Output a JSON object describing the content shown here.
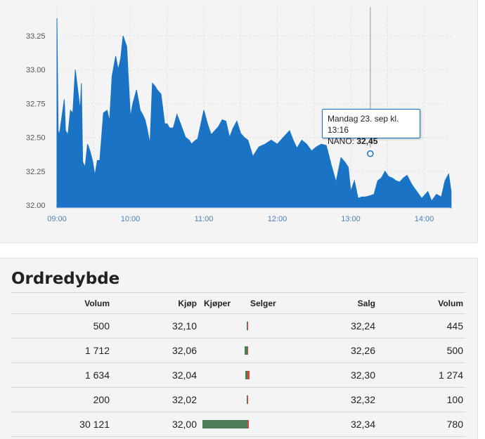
{
  "chart": {
    "x_ticks": [
      "09:00",
      "10:00",
      "11:00",
      "12:00",
      "13:00",
      "14:00"
    ],
    "y_ticks": [
      "33.25",
      "33.00",
      "32.75",
      "32.50",
      "32.25",
      "32.00"
    ],
    "tooltip": {
      "line1": "Mandag 23. sep kl. 13:16",
      "series": "NANO: ",
      "value": "32,45"
    },
    "colors": {
      "area": "#1a73c4",
      "axis_text": "#555555",
      "x_text": "#4a80b8"
    }
  },
  "chart_data": {
    "type": "area",
    "x_unit": "time",
    "ylim": [
      32.0,
      33.3
    ],
    "xlim": [
      "09:00",
      "14:22"
    ],
    "x": [
      "09:00",
      "09:01",
      "09:02",
      "09:04",
      "09:06",
      "09:07",
      "09:09",
      "09:11",
      "09:13",
      "09:15",
      "09:17",
      "09:19",
      "09:20",
      "09:21",
      "09:23",
      "09:25",
      "09:27",
      "09:29",
      "09:31",
      "09:33",
      "09:35",
      "09:38",
      "09:41",
      "09:43",
      "09:45",
      "09:48",
      "09:50",
      "09:52",
      "09:54",
      "09:57",
      "10:00",
      "10:02",
      "10:05",
      "10:08",
      "10:10",
      "10:12",
      "10:14",
      "10:16",
      "10:18",
      "10:20",
      "10:22",
      "10:25",
      "10:28",
      "10:30",
      "10:32",
      "10:35",
      "10:38",
      "10:41",
      "10:43",
      "10:45",
      "10:48",
      "10:50",
      "10:52",
      "10:55",
      "11:00",
      "11:03",
      "11:06",
      "11:09",
      "11:12",
      "11:15",
      "11:18",
      "11:21",
      "11:24",
      "11:27",
      "11:30",
      "11:33",
      "11:36",
      "11:40",
      "11:45",
      "11:50",
      "11:55",
      "12:00",
      "12:05",
      "12:10",
      "12:13",
      "12:16",
      "12:20",
      "12:24",
      "12:28",
      "12:32",
      "12:36",
      "12:40",
      "12:44",
      "12:48",
      "12:52",
      "12:55",
      "12:58",
      "13:00",
      "13:03",
      "13:06",
      "13:09",
      "13:12",
      "13:16",
      "13:19",
      "13:22",
      "13:25",
      "13:28",
      "13:31",
      "13:34",
      "13:37",
      "13:40",
      "13:43",
      "13:46",
      "13:50",
      "13:54",
      "13:58",
      "14:00",
      "14:03",
      "14:06",
      "14:10",
      "14:14",
      "14:17",
      "14:20",
      "14:22"
    ],
    "values": [
      33.38,
      32.55,
      32.52,
      32.65,
      32.78,
      32.55,
      32.52,
      32.7,
      32.68,
      33.0,
      32.85,
      32.7,
      32.9,
      32.32,
      32.28,
      32.45,
      32.4,
      32.33,
      32.22,
      32.33,
      32.33,
      32.68,
      32.7,
      32.62,
      32.95,
      33.1,
      33.0,
      33.08,
      33.25,
      33.17,
      32.65,
      32.75,
      32.85,
      32.7,
      32.67,
      32.63,
      32.55,
      32.45,
      32.9,
      32.88,
      32.85,
      32.82,
      32.6,
      32.6,
      32.57,
      32.57,
      32.67,
      32.6,
      32.55,
      32.5,
      32.48,
      32.45,
      32.47,
      32.49,
      32.7,
      32.6,
      32.52,
      32.55,
      32.58,
      32.63,
      32.62,
      32.5,
      32.57,
      32.62,
      32.53,
      32.5,
      32.48,
      32.36,
      32.43,
      32.45,
      32.48,
      32.45,
      32.5,
      32.55,
      32.48,
      32.42,
      32.48,
      32.45,
      32.4,
      32.43,
      32.45,
      32.44,
      32.3,
      32.17,
      32.35,
      32.32,
      32.28,
      32.1,
      32.18,
      32.05,
      32.06,
      32.06,
      32.07,
      32.08,
      32.18,
      32.2,
      32.25,
      32.21,
      32.2,
      32.18,
      32.17,
      32.2,
      32.22,
      32.15,
      32.1,
      32.05,
      32.07,
      32.1,
      32.03,
      32.08,
      32.06,
      32.18,
      32.23,
      32.1
    ]
  },
  "depth": {
    "title": "Ordredybde",
    "headers": {
      "volume_buy": "Volum",
      "buy": "Kjøp",
      "buyer": "Kjøper",
      "seller": "Selger",
      "sell": "Salg",
      "volume_sell": "Volum"
    },
    "rows": [
      {
        "buy_volume": "500",
        "buy_price": "32,10",
        "sell_price": "32,24",
        "sell_volume": "445",
        "buyer_bar": 0.0166,
        "seller_bar": 0.0148
      },
      {
        "buy_volume": "1 712",
        "buy_price": "32,06",
        "sell_price": "32,26",
        "sell_volume": "500",
        "buyer_bar": 0.0568,
        "seller_bar": 0.0166
      },
      {
        "buy_volume": "1 634",
        "buy_price": "32,04",
        "sell_price": "32,30",
        "sell_volume": "1 274",
        "buyer_bar": 0.0542,
        "seller_bar": 0.0423
      },
      {
        "buy_volume": "200",
        "buy_price": "32,02",
        "sell_price": "32,32",
        "sell_volume": "100",
        "buyer_bar": 0.0066,
        "seller_bar": 0.0033
      },
      {
        "buy_volume": "30 121",
        "buy_price": "32,00",
        "sell_price": "32,34",
        "sell_volume": "780",
        "buyer_bar": 1.0,
        "seller_bar": 0.0259
      }
    ]
  }
}
